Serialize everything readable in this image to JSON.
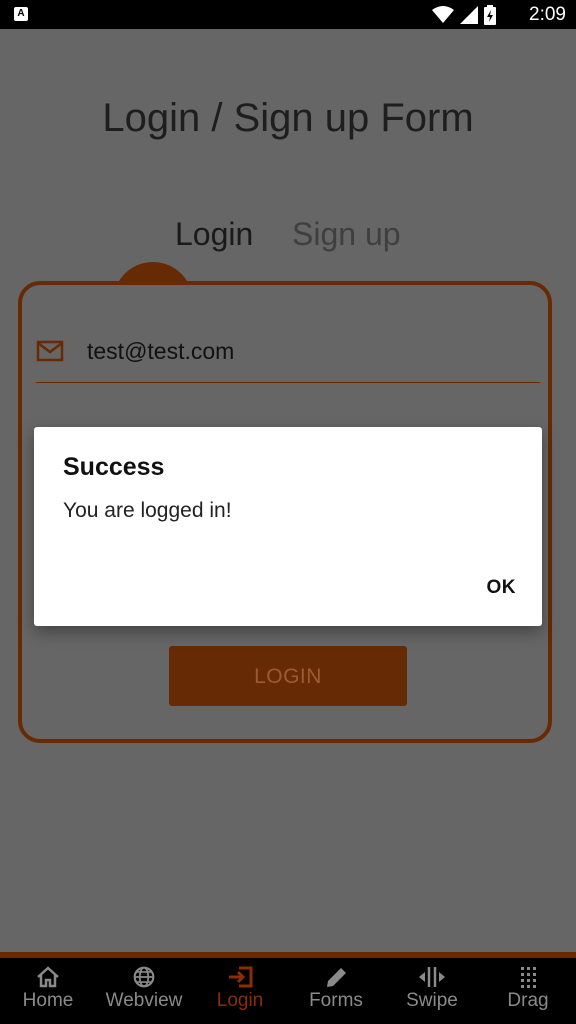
{
  "status_bar": {
    "time": "2:09",
    "notification_letter": "A"
  },
  "page": {
    "title": "Login / Sign up Form",
    "tabs": [
      {
        "label": "Login",
        "active": true
      },
      {
        "label": "Sign up",
        "active": false
      }
    ]
  },
  "form": {
    "email_value": "test@test.com",
    "login_button_label": "LOGIN"
  },
  "dialog": {
    "title": "Success",
    "message": "You are logged in!",
    "ok_label": "OK"
  },
  "bottom_nav": {
    "items": [
      {
        "label": "Home",
        "icon": "home-icon"
      },
      {
        "label": "Webview",
        "icon": "globe-icon"
      },
      {
        "label": "Login",
        "icon": "login-icon",
        "active": true
      },
      {
        "label": "Forms",
        "icon": "pencil-icon"
      },
      {
        "label": "Swipe",
        "icon": "swipe-icon"
      },
      {
        "label": "Drag",
        "icon": "drag-icon"
      }
    ]
  },
  "colors": {
    "accent": "#662a05",
    "active_nav": "#8a2e05",
    "overlay_bg": "#666666"
  }
}
